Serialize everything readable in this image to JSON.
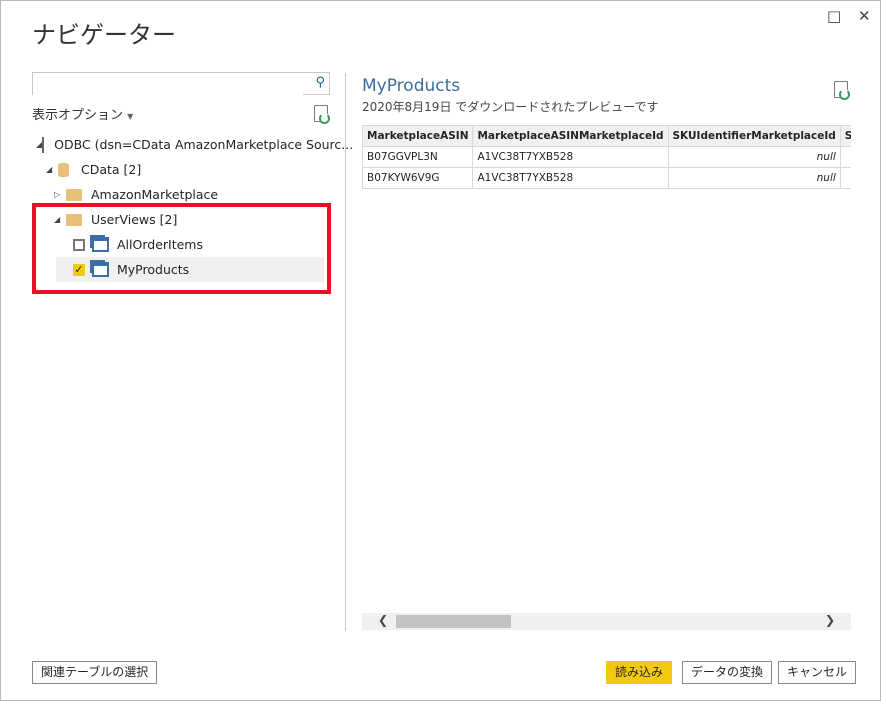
{
  "window": {
    "title": "ナビゲーター",
    "maximize_icon": "□",
    "close_icon": "✕"
  },
  "left": {
    "search": {
      "value": "",
      "placeholder": ""
    },
    "options_label": "表示オプション",
    "tree": [
      {
        "label": "ODBC (dsn=CData AmazonMarketplace Sourc..."
      },
      {
        "label": "CData [2]"
      },
      {
        "label": "AmazonMarketplace"
      },
      {
        "label": "UserViews [2]"
      },
      {
        "label": "AllOrderItems",
        "checked": false
      },
      {
        "label": "MyProducts",
        "checked": true
      }
    ]
  },
  "preview": {
    "title": "MyProducts",
    "subtitle": "2020年8月19日 でダウンロードされたプレビューです",
    "columns": [
      "MarketplaceASIN",
      "MarketplaceASINMarketplaceId",
      "SKUIdentifierMarketplaceId",
      "SKU"
    ],
    "rows": [
      [
        "B07GGVPL3N",
        "A1VC38T7YXB528",
        "null",
        ""
      ],
      [
        "B07KYW6V9G",
        "A1VC38T7YXB528",
        "null",
        ""
      ]
    ]
  },
  "footer": {
    "select_related": "関連テーブルの選択",
    "load": "読み込み",
    "transform": "データの変換",
    "cancel": "キャンセル"
  },
  "colors": {
    "accent": "#f2c811",
    "highlight": "#e81123",
    "title": "#3c6e9e"
  }
}
